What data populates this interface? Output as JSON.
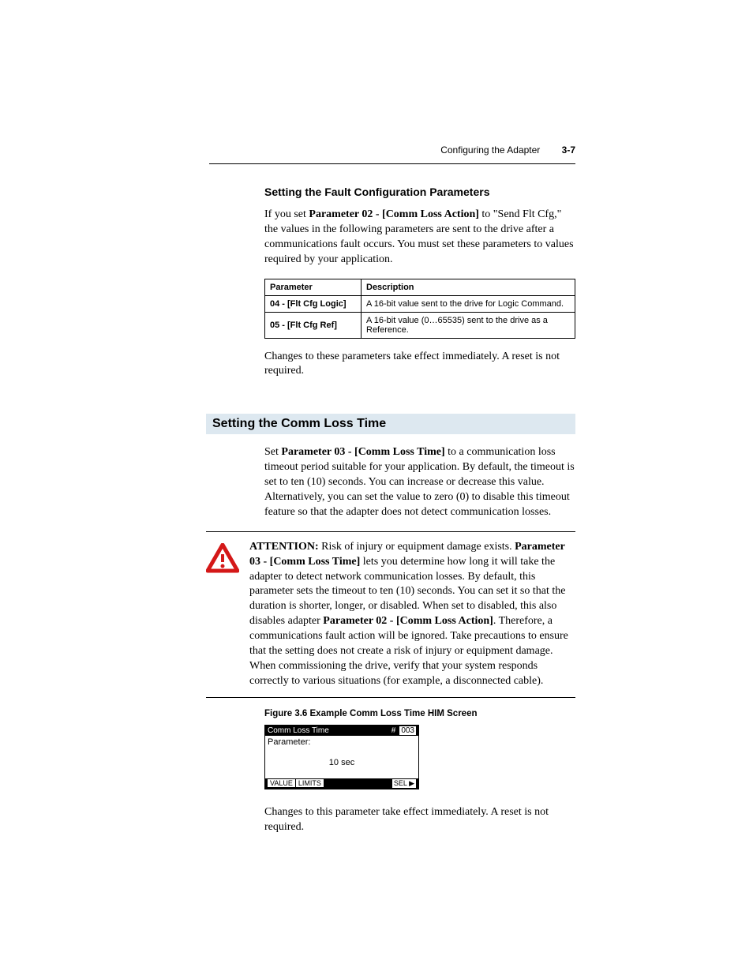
{
  "header": {
    "title": "Configuring the Adapter",
    "page": "3-7"
  },
  "section1": {
    "heading": "Setting the Fault Configuration Parameters",
    "para1_pre": "If you set ",
    "para1_bold": "Parameter 02 - [Comm Loss Action]",
    "para1_post": " to \"Send Flt Cfg,\" the values in the following parameters are sent to the drive after a communications fault occurs. You must set these parameters to values required by your application.",
    "table": {
      "col1": "Parameter",
      "col2": "Description",
      "rows": [
        {
          "param": "04 - [Flt Cfg Logic]",
          "desc": "A 16-bit value sent to the drive for Logic Command."
        },
        {
          "param": "05 - [Flt Cfg Ref]",
          "desc": "A 16-bit value (0…65535) sent to the drive as a Reference."
        }
      ]
    },
    "para2": "Changes to these parameters take effect immediately. A reset is not required."
  },
  "section2": {
    "heading": "Setting the Comm Loss Time",
    "para1_pre": "Set ",
    "para1_bold": "Parameter 03 - [Comm Loss Time]",
    "para1_post": " to a communication loss timeout period suitable for your application. By default, the timeout is set to ten (10) seconds. You can increase or decrease this value. Alternatively, you can set the value to zero (0) to disable this timeout feature so that the adapter does not detect communication losses."
  },
  "attention": {
    "label": "ATTENTION:",
    "text1": "  Risk of injury or equipment damage exists. ",
    "bold1": "Parameter 03 - [Comm Loss Time]",
    "text2": " lets you determine how long it will take the adapter to detect network communication losses. By default, this parameter sets the timeout to ten (10) seconds. You can set it so that the duration is shorter, longer, or disabled. When set to disabled, this also disables adapter ",
    "bold2": "Parameter 02 - [Comm Loss Action]",
    "text3": ". Therefore, a communications fault action will be ignored. Take precautions to ensure that the setting does not create a risk of injury or equipment damage. When commissioning the drive, verify that your system responds correctly to various situations (for example, a disconnected cable)."
  },
  "figure": {
    "caption": "Figure 3.6   Example Comm Loss Time HIM Screen"
  },
  "him": {
    "title": "Comm Loss Time",
    "hash": "#",
    "num": "003",
    "row2": "Parameter:",
    "value": "10 sec",
    "tab1": "VALUE",
    "tab2": "LIMITS",
    "sel": "SEL ▶"
  },
  "closing": "Changes to this parameter take effect immediately. A reset is not required."
}
